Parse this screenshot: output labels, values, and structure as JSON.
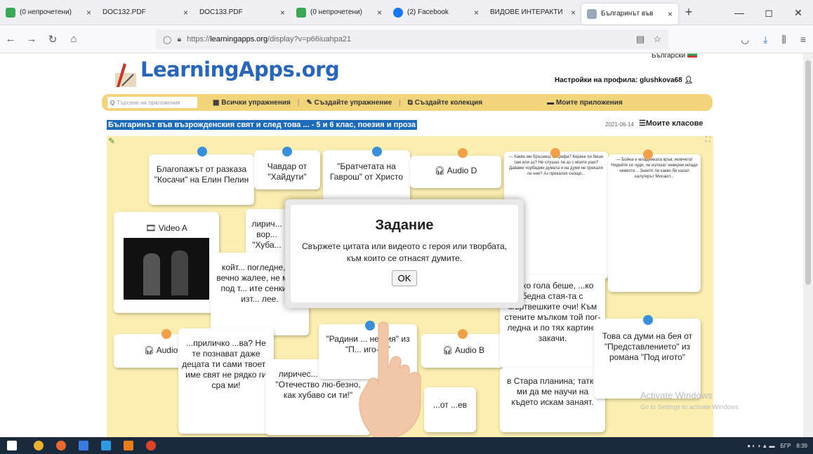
{
  "tabs": [
    {
      "label": "(0 непрочетени)",
      "color": "#3aa757"
    },
    {
      "label": "DOC132.PDF",
      "color": ""
    },
    {
      "label": "DOC133.PDF",
      "color": ""
    },
    {
      "label": "(0 непрочетени)",
      "color": "#3aa757"
    },
    {
      "label": "(2) Facebook",
      "color": "#1877f2"
    },
    {
      "label": "ВИДОВЕ ИНТЕРАКТИ",
      "color": ""
    },
    {
      "label": "Българинът във",
      "color": "#9ab"
    }
  ],
  "url": {
    "prefix": "https://",
    "domain": "learningapps.org",
    "path": "/display?v=p66iuahpa21"
  },
  "site": {
    "logo": "LearningApps.org",
    "lang": "Български",
    "profile": "Настройки на профила: glushkova68",
    "search_placeholder": "Търсене на приложения",
    "menu": [
      "Всички упражнения",
      "Създайте упражнение",
      "Създайте колекция",
      "Моите приложения"
    ],
    "title": "Българинът във възрожденския свят и след това ... - 5 и 6 клас, поезия и проза",
    "date": "2021-06-14",
    "classes": "Моите класове"
  },
  "cards": [
    "Благопажът от разказа \"Косачи\" на Елин Пелин",
    "Чавдар от \"Хайдути\"",
    "\"Братчетата на Гаврош\" от Христо",
    "Audio D",
    "Video A",
    "лирич... вор... \"Хуба...",
    "койт... погледне, т... вечно жалее, не може под т... ите сенки да изт... лее.",
    "Audio C",
    "...приличко ...ва? Не те познават даже децата ти сами твоето име свят не рядко ги сра ми!",
    "лиричес... вориет от \"Отечество лю-безно, как хубаво си ти!\"",
    "\"Радини ... не-ния\" из \"П... иго-то\"",
    "Audio B",
    "...тко гола беше, ...ко бедна стая-та с мъртвешките очи! Към стените мълком той пог-ледна и по тях картини закачи.",
    "в Стара планина; татко ми да ме научи на където искам занаят.",
    "Това са думи на бея от \"Представлението\" из романа \"Под игото\"",
    "...от ...ев"
  ],
  "small_cards": [
    "— Какво ми бръснеш, шерифа? Керкек ли беше там или аз? Не слушах ли аз с моите уши? Даваме чорбаджи думата и на думи не прекаля ли ние? Аз прекалих снощи...",
    "— Бойна е младежката кръв, момчета! Недейте се чуди, че излязат неверни млади невести... Знаете ли какво бе казал калугерът Мисаил..."
  ],
  "modal": {
    "title": "Задание",
    "text": "Свържете цитата или видеото с героя или творбата, към които се отнасят думите.",
    "ok": "OK"
  },
  "watermark": {
    "line1": "Activate Windows",
    "line2": "Go to Settings to activate Windows."
  },
  "tray": {
    "lang": "БГР",
    "time": "8:39"
  },
  "colors": {
    "pin_blue": "#3a8fd8",
    "pin_orange": "#f0a048",
    "board": "#fbeeb0",
    "menubar": "#f2d47a"
  }
}
